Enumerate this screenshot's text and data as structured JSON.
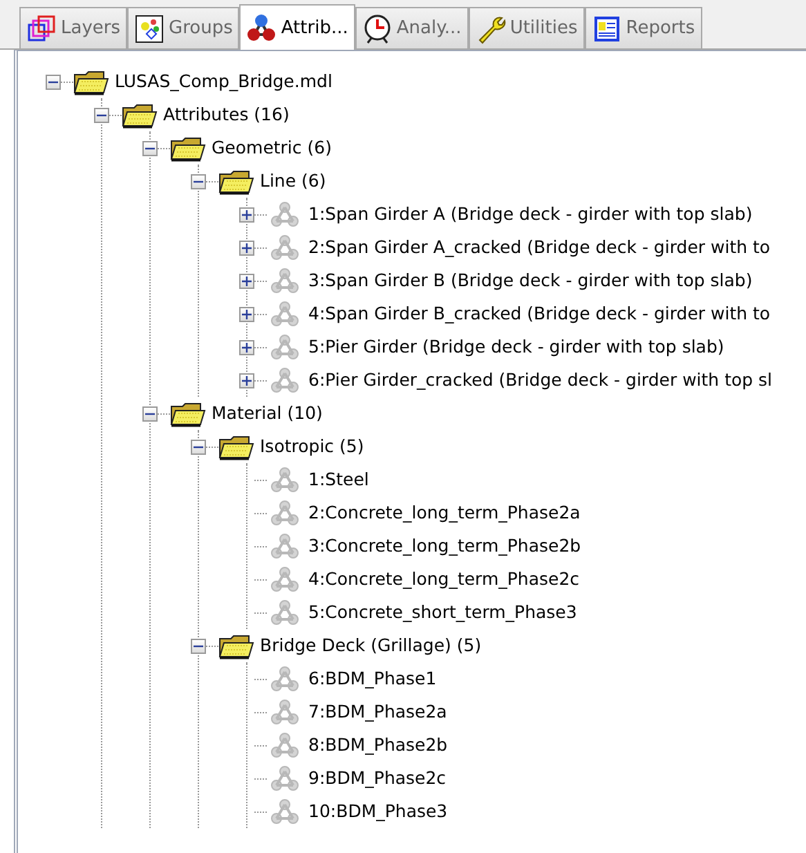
{
  "tabs": [
    {
      "label": "Layers",
      "kind": "layers",
      "selected": false
    },
    {
      "label": "Groups",
      "kind": "groups",
      "selected": false
    },
    {
      "label": "Attrib...",
      "kind": "attributes",
      "selected": true
    },
    {
      "label": "Analy...",
      "kind": "analysis",
      "selected": false
    },
    {
      "label": "Utilities",
      "kind": "utilities",
      "selected": false
    },
    {
      "label": "Reports",
      "kind": "reports",
      "selected": false
    }
  ],
  "tree": [
    {
      "label": "LUSAS_Comp_Bridge.mdl",
      "kind": "folder",
      "expanded": true,
      "children": [
        {
          "label": "Attributes (16)",
          "kind": "folder",
          "expanded": true,
          "children": [
            {
              "label": "Geometric (6)",
              "kind": "folder",
              "expanded": true,
              "children": [
                {
                  "label": "Line (6)",
                  "kind": "folder",
                  "expanded": true,
                  "children": [
                    {
                      "label": "1:Span Girder A (Bridge deck - girder with top slab)",
                      "kind": "attribute",
                      "expanded": false
                    },
                    {
                      "label": "2:Span Girder A_cracked (Bridge deck - girder with to",
                      "kind": "attribute",
                      "expanded": false
                    },
                    {
                      "label": "3:Span Girder B (Bridge deck - girder with top slab)",
                      "kind": "attribute",
                      "expanded": false
                    },
                    {
                      "label": "4:Span Girder B_cracked (Bridge deck - girder with to",
                      "kind": "attribute",
                      "expanded": false
                    },
                    {
                      "label": "5:Pier Girder (Bridge deck - girder with top slab)",
                      "kind": "attribute",
                      "expanded": false
                    },
                    {
                      "label": "6:Pier Girder_cracked (Bridge deck - girder with top sl",
                      "kind": "attribute",
                      "expanded": false
                    }
                  ]
                }
              ]
            },
            {
              "label": "Material (10)",
              "kind": "folder",
              "expanded": true,
              "children": [
                {
                  "label": "Isotropic (5)",
                  "kind": "folder",
                  "expanded": true,
                  "children": [
                    {
                      "label": "1:Steel",
                      "kind": "attribute"
                    },
                    {
                      "label": "2:Concrete_long_term_Phase2a",
                      "kind": "attribute"
                    },
                    {
                      "label": "3:Concrete_long_term_Phase2b",
                      "kind": "attribute"
                    },
                    {
                      "label": "4:Concrete_long_term_Phase2c",
                      "kind": "attribute"
                    },
                    {
                      "label": "5:Concrete_short_term_Phase3",
                      "kind": "attribute"
                    }
                  ]
                },
                {
                  "label": "Bridge Deck (Grillage) (5)",
                  "kind": "folder",
                  "expanded": true,
                  "children": [
                    {
                      "label": "6:BDM_Phase1",
                      "kind": "attribute"
                    },
                    {
                      "label": "7:BDM_Phase2a",
                      "kind": "attribute"
                    },
                    {
                      "label": "8:BDM_Phase2b",
                      "kind": "attribute"
                    },
                    {
                      "label": "9:BDM_Phase2c",
                      "kind": "attribute"
                    },
                    {
                      "label": "10:BDM_Phase3",
                      "kind": "attribute"
                    }
                  ]
                }
              ]
            }
          ]
        }
      ]
    }
  ]
}
